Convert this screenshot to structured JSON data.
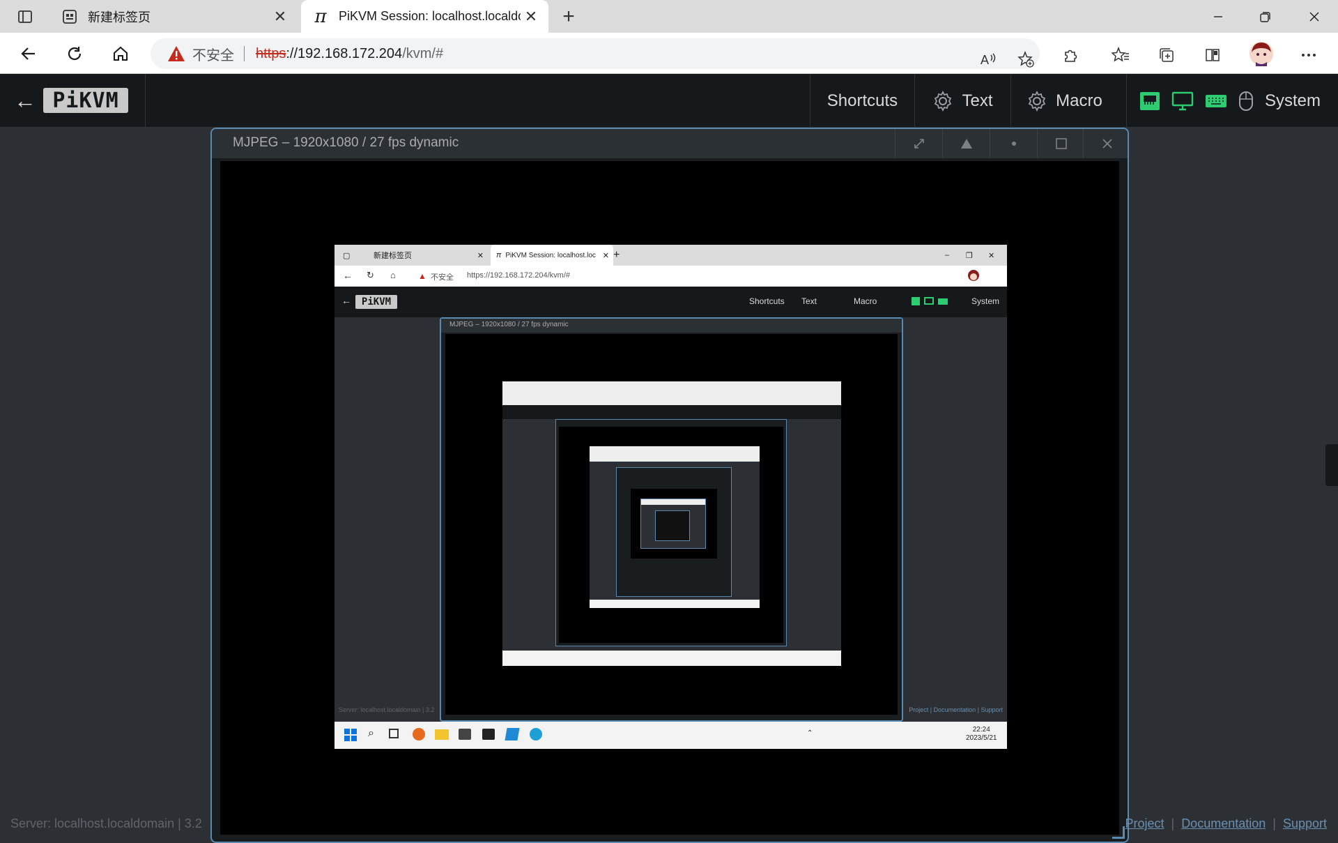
{
  "browser": {
    "tabs": [
      {
        "title": "新建标签页",
        "icon": "new-tab-page-icon"
      },
      {
        "title": "PiKVM Session: localhost.localdo",
        "icon": "pi-icon"
      }
    ],
    "address": {
      "security_label": "不安全",
      "url_protocol": "https",
      "url_host": "://192.168.172.204",
      "url_path": "/kvm/#"
    }
  },
  "kvm": {
    "logo": "PiKVM",
    "menu": {
      "shortcuts": "Shortcuts",
      "text": "Text",
      "macro": "Macro",
      "system": "System"
    },
    "stream": {
      "title": "MJPEG – 1920x1080 / 27 fps dynamic"
    },
    "remote": {
      "tab1": "新建标签页",
      "tab2": "PiKVM Session: localhost.localdo",
      "security_label": "不安全",
      "url": "https://192.168.172.204/kvm/#",
      "logo": "PiKVM",
      "shortcuts": "Shortcuts",
      "text": "Text",
      "macro": "Macro",
      "system": "System",
      "stream_title": "MJPEG – 1920x1080 / 27 fps dynamic",
      "server_text": "Server: localhost.localdomain  |  3.2",
      "footer_links": "Project  |  Documentation  |  Support",
      "clock_time": "22:24",
      "clock_date": "2023/5/21"
    },
    "footer": {
      "server": "Server: localhost.localdomain  |  3.2",
      "link_project": "Project",
      "link_documentation": "Documentation",
      "link_support": "Support"
    },
    "colors": {
      "accent": "#5b8ab0",
      "indicator_green": "#2ecc71",
      "nav_bg": "#16191c",
      "page_bg": "#2c3034"
    }
  }
}
